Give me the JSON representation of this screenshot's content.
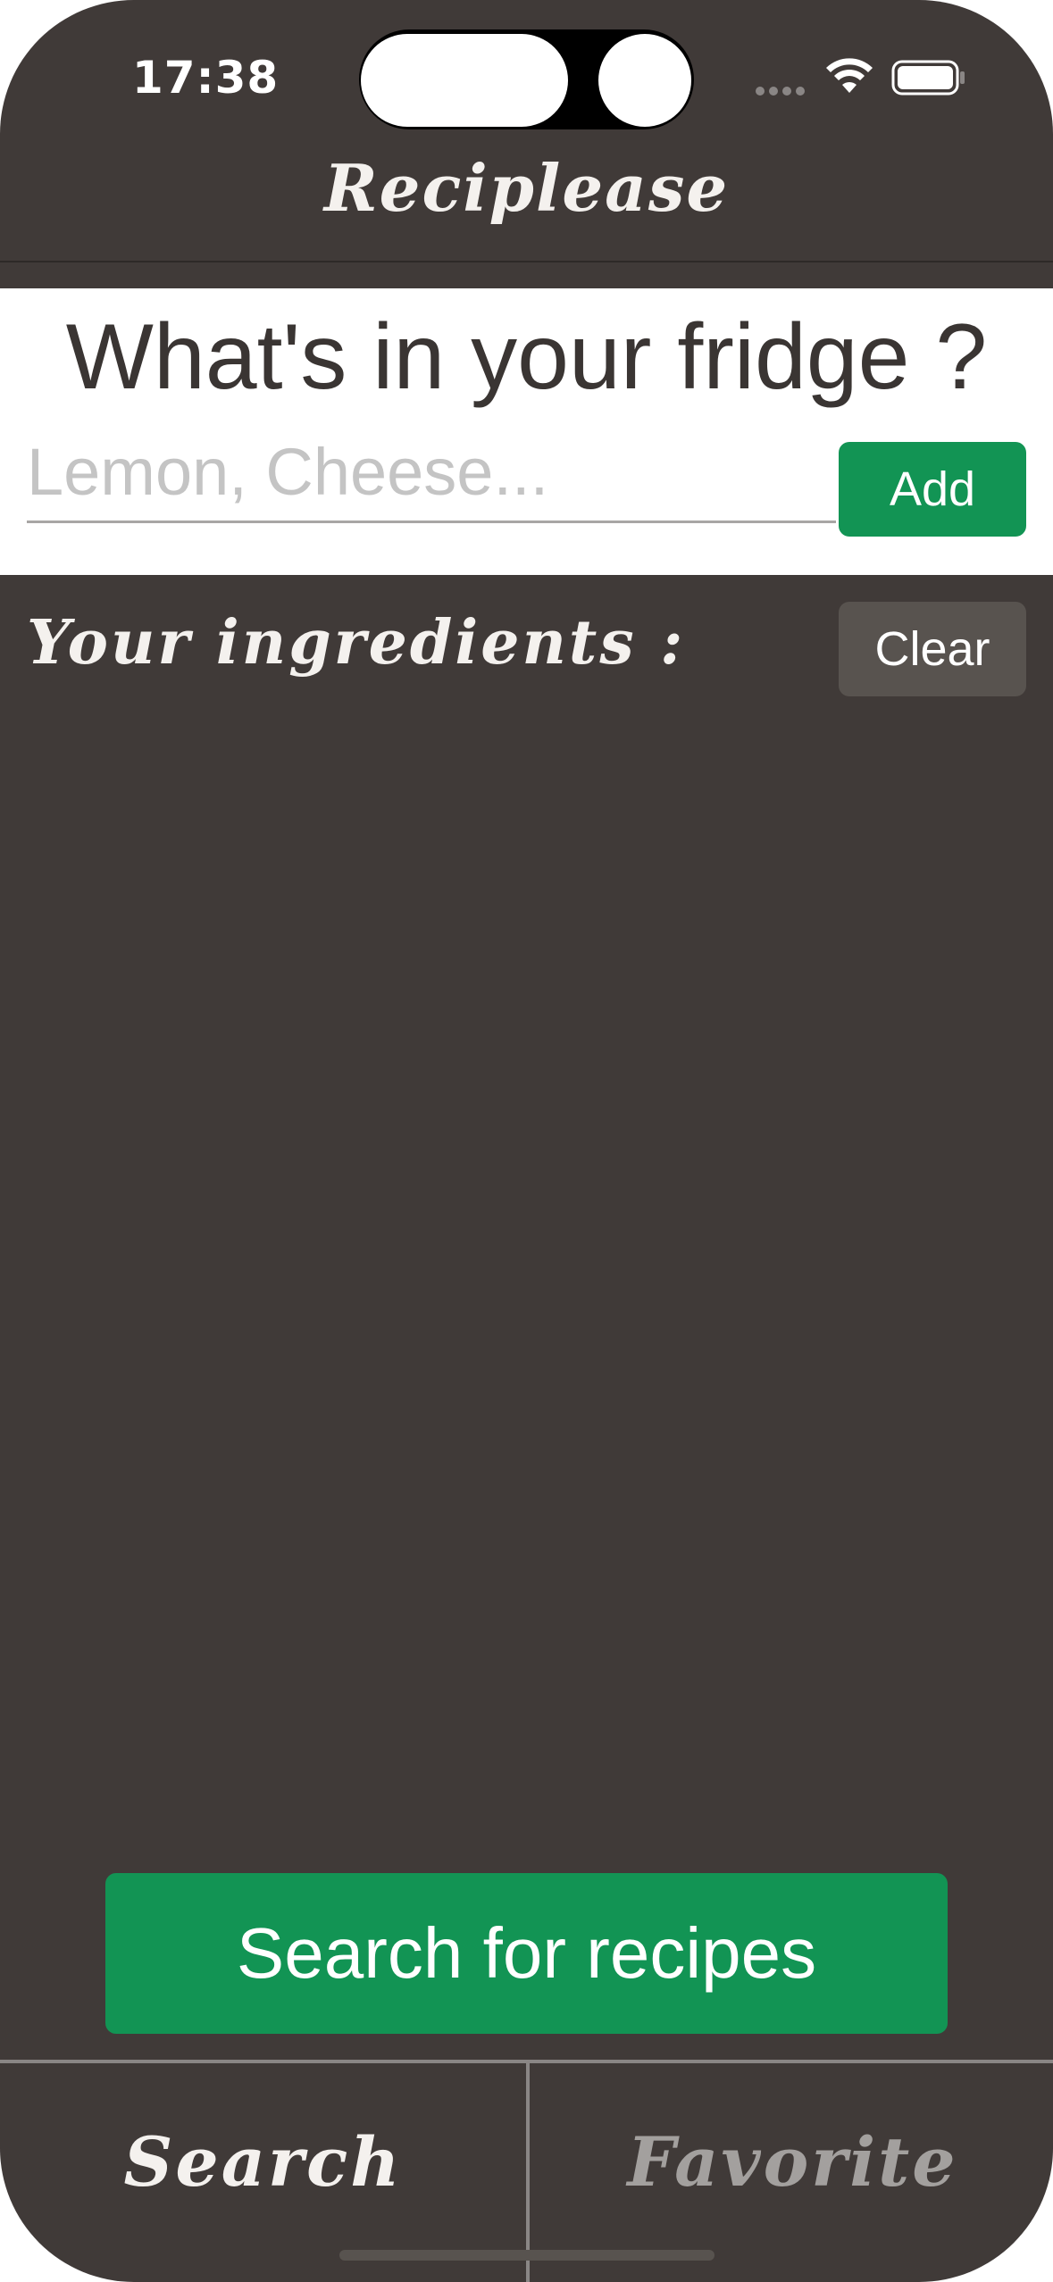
{
  "status_bar": {
    "time": "17:38"
  },
  "nav": {
    "title": "Reciplease"
  },
  "fridge": {
    "heading": "What's in your fridge ?",
    "input_placeholder": "Lemon, Cheese...",
    "input_value": "",
    "add_label": "Add"
  },
  "ingredients": {
    "label": "Your ingredients :",
    "clear_label": "Clear",
    "items": []
  },
  "actions": {
    "search_label": "Search for recipes"
  },
  "tabs": [
    {
      "label": "Search",
      "selected": true
    },
    {
      "label": "Favorite",
      "selected": false
    }
  ],
  "colors": {
    "background": "#403a38",
    "accent_green": "#129454",
    "clear_button": "#58534f",
    "tab_inactive": "#a3a09e"
  },
  "icons": {
    "wifi": "wifi-icon",
    "battery": "battery-icon",
    "signal": "cellular-signal-icon"
  }
}
